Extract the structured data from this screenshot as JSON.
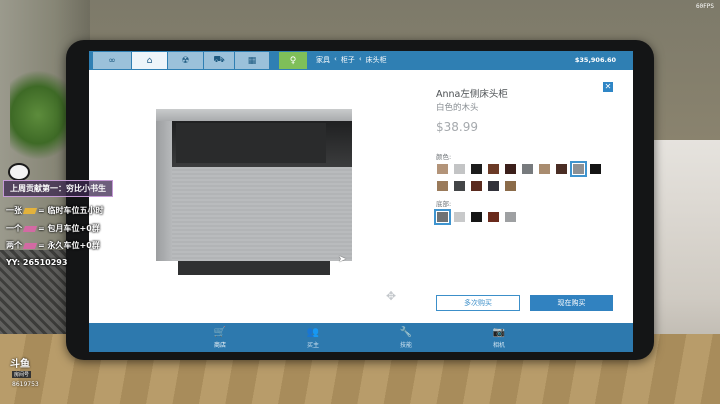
{
  "hud": {
    "fps": "60FPS"
  },
  "tablet": {
    "tabs": [
      {
        "icon": "∞",
        "name": "tab-loop"
      },
      {
        "icon": "⌂",
        "name": "tab-home"
      },
      {
        "icon": "☢",
        "name": "tab-hazard"
      },
      {
        "icon": "⛟",
        "name": "tab-vehicle"
      },
      {
        "icon": "▦",
        "name": "tab-chip"
      },
      {
        "icon": "♀",
        "name": "tab-green"
      }
    ],
    "breadcrumb": [
      "家具",
      "‹",
      "柜子",
      "‹",
      "床头柜"
    ],
    "balance": "$35,906.60",
    "product": {
      "name": "Anna左侧床头柜",
      "description": "白色的木头",
      "price": "$38.99",
      "color_label": "颜色:",
      "base_label": "底部:",
      "colors": [
        "#b39479",
        "#c3c4c5",
        "#1c1c1c",
        "#6b3a26",
        "#3b1f1a",
        "#777a7d",
        "#a98c6f",
        "#4a2d24",
        "#8e9194",
        "#141414",
        "#9a7a5a",
        "#434547",
        "#5a2a1e",
        "#31313a",
        "#8b6b49"
      ],
      "selected_color_index": 8,
      "base_colors": [
        "#6f7274",
        "#c8c9ca",
        "#161616",
        "#6a2a1c",
        "#9ea0a2"
      ],
      "selected_base_index": 0,
      "multi_buy": "多次购买",
      "buy_now": "现在购买"
    },
    "bottom_nav": [
      {
        "label": "商店",
        "icon": "🛒",
        "active": true,
        "name": "nav-shop"
      },
      {
        "label": "买主",
        "icon": "👥",
        "active": false,
        "name": "nav-buyer"
      },
      {
        "label": "技能",
        "icon": "🔧",
        "active": false,
        "name": "nav-skills"
      },
      {
        "label": "相机",
        "icon": "📷",
        "active": false,
        "name": "nav-camera"
      }
    ]
  },
  "stream_overlay": {
    "banner": "上周贡献第一：穷比小书生",
    "line1": {
      "a": "一张",
      "b": "= 临时车位五小时"
    },
    "line2": {
      "a": "一个",
      "b": "= 包月车位+0群"
    },
    "line3": {
      "a": "两个",
      "b": "= 永久车位+0群"
    },
    "yy": "YY: 26510293",
    "logo": "斗鱼",
    "logo_sub": "房间号",
    "room_id": "8619753"
  }
}
